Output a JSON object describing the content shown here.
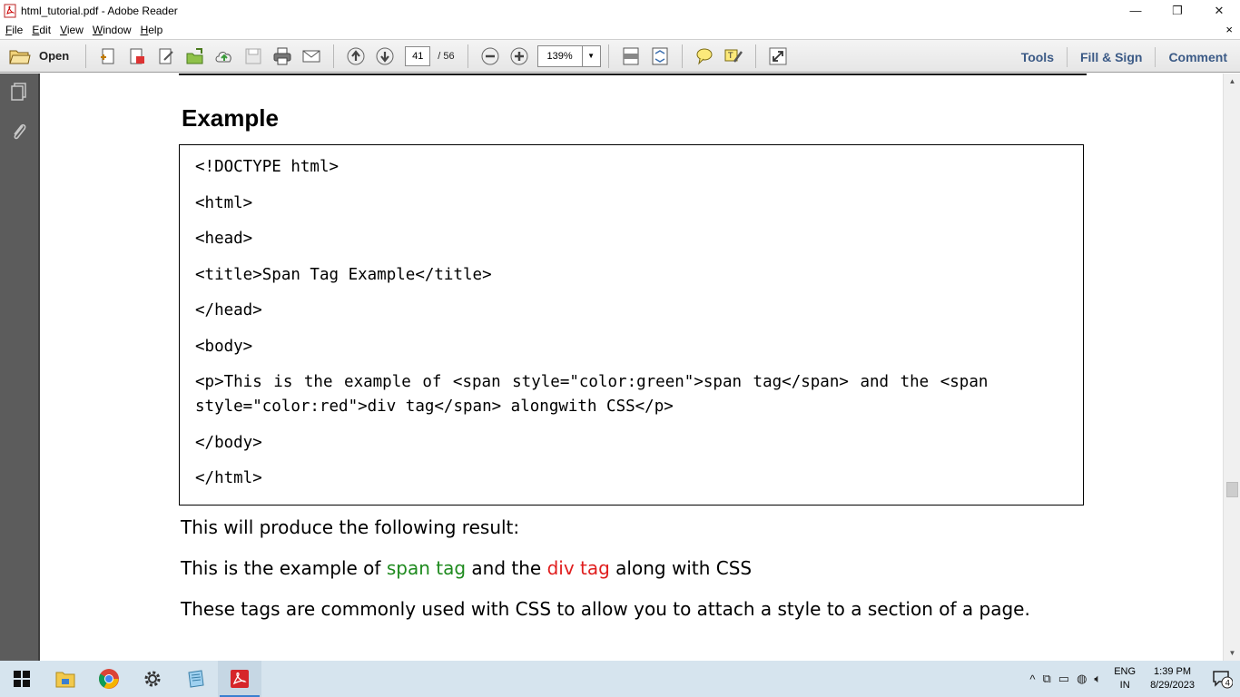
{
  "window": {
    "title": "html_tutorial.pdf - Adobe Reader",
    "minimize": "—",
    "restore": "❐",
    "close": "✕"
  },
  "menu": {
    "items": [
      {
        "accel": "F",
        "rest": "ile"
      },
      {
        "accel": "E",
        "rest": "dit"
      },
      {
        "accel": "V",
        "rest": "iew"
      },
      {
        "accel": "W",
        "rest": "indow"
      },
      {
        "accel": "H",
        "rest": "elp"
      }
    ],
    "close": "×"
  },
  "toolbar": {
    "open_label": "Open",
    "page_current": "41",
    "page_total": "/ 56",
    "zoom": "139%",
    "tools": "Tools",
    "fill_sign": "Fill & Sign",
    "comment": "Comment"
  },
  "document": {
    "heading": "Example",
    "code_lines": [
      "<!DOCTYPE html>",
      "<html>",
      "<head>",
      "<title>Span Tag Example</title>",
      "</head>",
      "<body>",
      "<p>This is the example of <span style=\"color:green\">span tag</span> and the <span",
      "style=\"color:red\">div tag</span> alongwith CSS</p>",
      "</body>",
      "</html>"
    ],
    "result_intro": "This will produce the following result:",
    "result": {
      "part1": "This is the example of ",
      "green": "span tag",
      "part2": " and the ",
      "red": "div tag",
      "part3": " along with CSS"
    },
    "closing": "These tags are commonly used with CSS to allow you to attach a style to a section of a page."
  },
  "taskbar": {
    "apps": [
      "start-icon",
      "file-explorer-icon",
      "chrome-icon",
      "settings-icon",
      "notepad-icon",
      "adobe-reader-icon"
    ],
    "lang_top": "ENG",
    "lang_bottom": "IN",
    "time": "1:39 PM",
    "date": "8/29/2023",
    "notifications": "4"
  },
  "colors": {
    "green_text": "#1e8a1e",
    "red_text": "#e01e1e",
    "toolbar_link": "#3b5a86",
    "left_nav": "#5c5c5c",
    "taskbar": "#d6e4ee"
  }
}
